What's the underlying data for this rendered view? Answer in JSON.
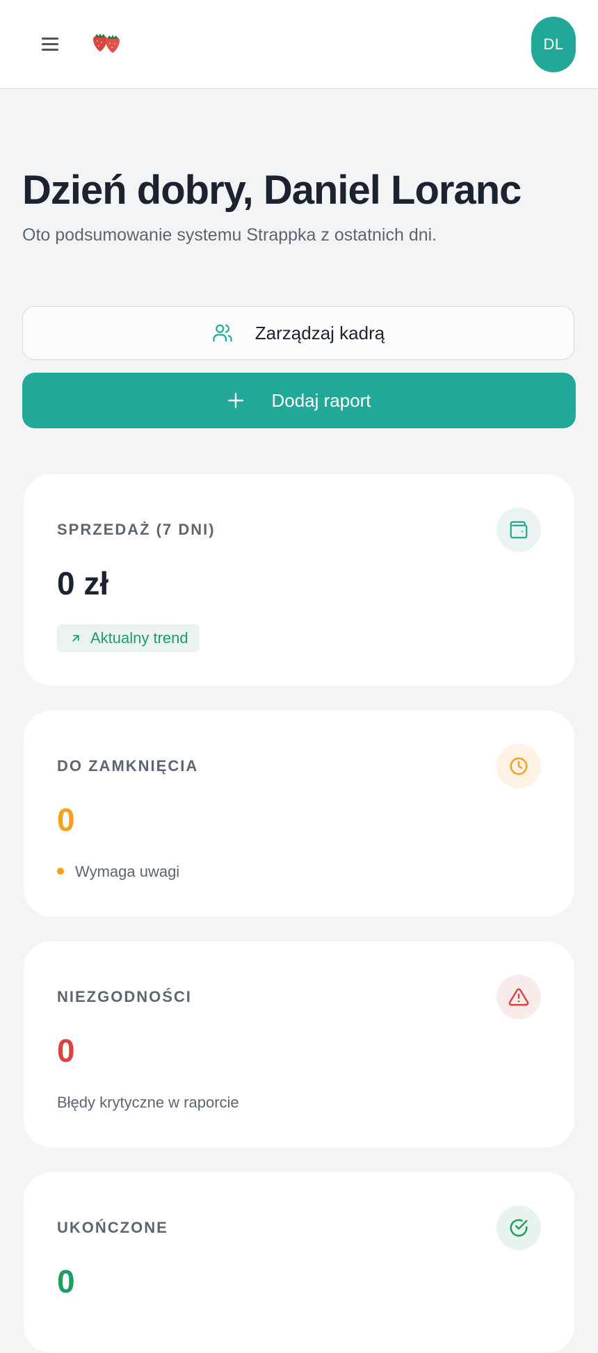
{
  "header": {
    "menu_icon": "hamburger-menu-icon",
    "logo_icon": "strawberries-logo",
    "avatar_initials": "DL"
  },
  "main": {
    "greeting": "Dzień dobry, Daniel Loranc",
    "subtitle": "Oto podsumowanie systemu Strappka z ostatnich dni."
  },
  "actions": {
    "manage_staff_label": "Zarządzaj kadrą",
    "manage_staff_icon": "users-icon",
    "add_report_label": "Dodaj raport",
    "add_report_icon": "plus-icon"
  },
  "cards": {
    "sales": {
      "label": "SPRZEDAŻ (7 DNI)",
      "value": "0 zł",
      "badge": "Aktualny trend",
      "icon": "wallet-icon"
    },
    "to_close": {
      "label": "DO ZAMKNIĘCIA",
      "value": "0",
      "note": "Wymaga uwagi",
      "icon": "clock-icon"
    },
    "nonconformities": {
      "label": "NIEZGODNOŚCI",
      "value": "0",
      "note": "Błędy krytyczne w raporcie",
      "icon": "warning-triangle-icon"
    },
    "completed": {
      "label": "UKOŃCZONE",
      "value": "0",
      "icon": "check-circle-icon"
    }
  },
  "colors": {
    "accent": "#22a898",
    "amber": "#f2a31b",
    "red": "#d9443f",
    "green": "#1e9e60"
  }
}
